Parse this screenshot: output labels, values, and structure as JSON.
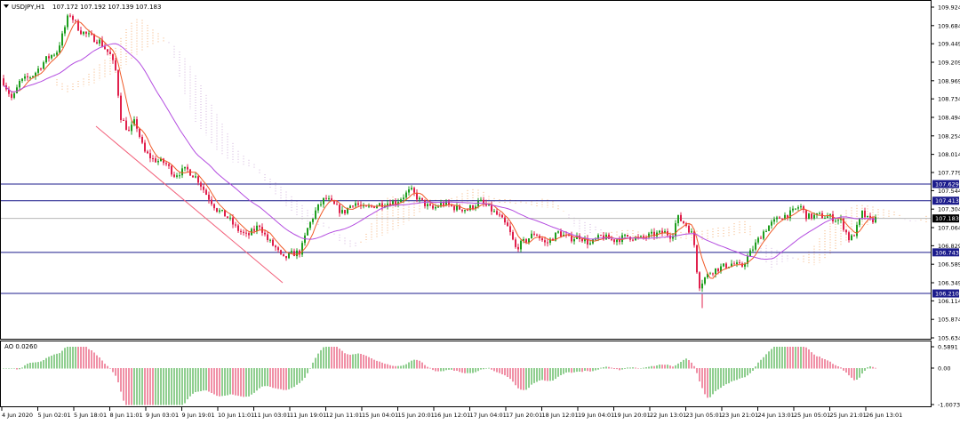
{
  "chart_data": [
    {
      "type": "candlestick",
      "header": {
        "symbol": "USDJPY,H1",
        "ohlc": "107.172 107.192 107.139 107.183"
      },
      "price_ticks": [
        "109.924",
        "109.684",
        "109.449",
        "109.209",
        "108.969",
        "108.734",
        "108.494",
        "108.254",
        "108.014",
        "107.779",
        "107.544",
        "107.304",
        "107.064",
        "106.829",
        "106.589",
        "106.349",
        "106.114",
        "105.874",
        "105.634"
      ],
      "ylim": [
        105.634,
        109.924
      ],
      "time_labels": [
        "4 Jun 2020",
        "5 Jun 02:01",
        "5 Jun 18:01",
        "8 Jun 11:01",
        "9 Jun 03:01",
        "9 Jun 19:01",
        "10 Jun 11:01",
        "11 Jun 03:01",
        "11 Jun 19:01",
        "12 Jun 11:01",
        "15 Jun 04:01",
        "15 Jun 20:01",
        "16 Jun 12:01",
        "17 Jun 04:01",
        "17 Jun 20:01",
        "18 Jun 12:01",
        "19 Jun 04:01",
        "19 Jun 20:01",
        "22 Jun 13:01",
        "23 Jun 05:01",
        "23 Jun 21:01",
        "24 Jun 13:01",
        "25 Jun 05:01",
        "25 Jun 21:01",
        "26 Jun 13:01"
      ],
      "horizontal_levels": [
        {
          "label": "107.629",
          "value": 107.629
        },
        {
          "label": "107.413",
          "value": 107.413
        },
        {
          "label": "106.743",
          "value": 106.743
        },
        {
          "label": "106.210",
          "value": 106.21
        }
      ],
      "current_price": {
        "label": "107.183",
        "value": 107.183
      },
      "colors": {
        "bull": "#1f9e1f",
        "bear": "#e0204c",
        "fast_ma": "#f05a28",
        "slow_ma": "#b44de0",
        "cloud": "#f3a25e",
        "level_line": "#1c1c8c",
        "level_tag": "#1c1c8c"
      }
    },
    {
      "type": "histogram",
      "title": "AO 0.0260",
      "ticks": [
        "0.5891",
        "0.00",
        "-1.0073"
      ],
      "ylim": [
        -1.0073,
        0.5891
      ]
    }
  ]
}
